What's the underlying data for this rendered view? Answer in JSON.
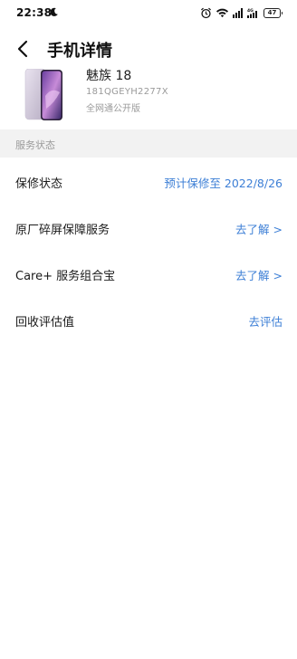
{
  "status_bar": {
    "time": "22:38",
    "battery": "47"
  },
  "header": {
    "title": "手机详情"
  },
  "device": {
    "name": "魅族 18",
    "serial": "181QGEYH2277X",
    "edition": "全网通公开版"
  },
  "section": {
    "title": "服务状态"
  },
  "rows": [
    {
      "label": "保修状态",
      "value": "预计保修至 2022/8/26"
    },
    {
      "label": "原厂碎屏保障服务",
      "value": "去了解 >"
    },
    {
      "label": "Care+ 服务组合宝",
      "value": "去了解 >"
    },
    {
      "label": "回收评估值",
      "value": "去评估"
    }
  ],
  "colors": {
    "accent": "#3d7fd6",
    "section_bg": "#f2f2f2",
    "muted_text": "#9a9a9a"
  },
  "icons": [
    "moon-icon",
    "alarm-icon",
    "wifi-icon",
    "signal-icon",
    "battery-icon",
    "back-arrow-icon"
  ]
}
